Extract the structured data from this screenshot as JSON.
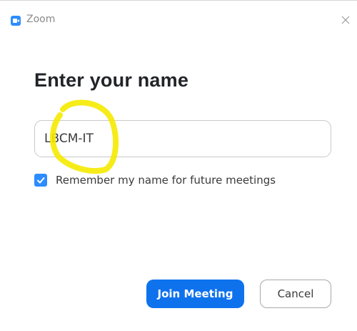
{
  "window": {
    "app_title": "Zoom",
    "app_icon": "zoom-camera-icon",
    "close_icon": "close-icon"
  },
  "main": {
    "heading": "Enter your name",
    "name_value": "LBCM-IT",
    "remember_checked": true,
    "remember_label": "Remember my name for future meetings"
  },
  "actions": {
    "join_label": "Join Meeting",
    "cancel_label": "Cancel"
  },
  "colors": {
    "accent": "#0e72ed",
    "checkbox": "#2d8cff",
    "highlight_marker": "#f5ea00"
  }
}
